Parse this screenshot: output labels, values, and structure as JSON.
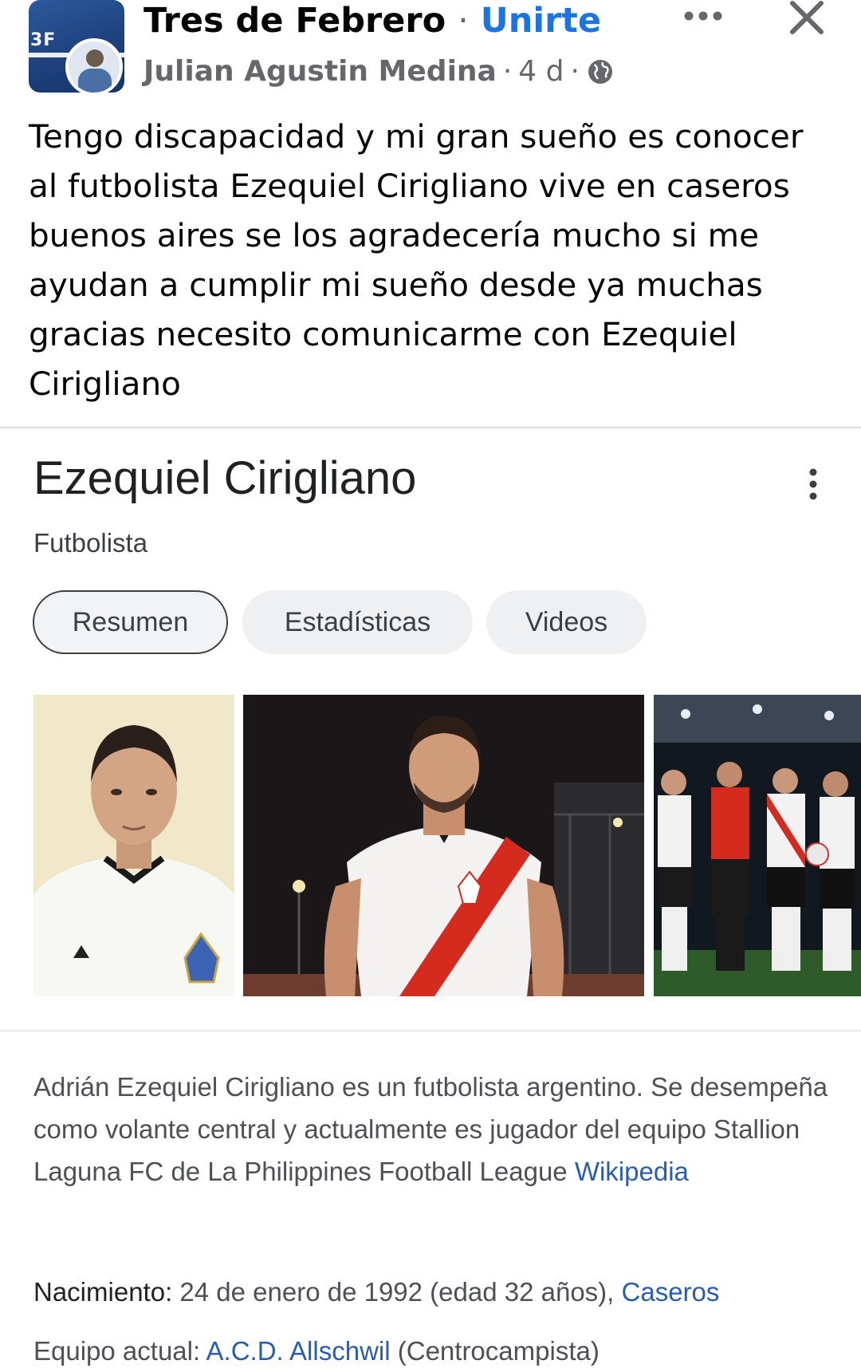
{
  "post": {
    "group_name": "Tres de Febrero",
    "separator": "·",
    "join_label": "Unirte",
    "author": "Julian Agustin Medina",
    "time": "4 d",
    "privacy_icon": "globe-icon",
    "more_icon": "more-horizontal-icon",
    "close_icon": "close-icon",
    "group_avatar_text": "3F",
    "text": "Tengo discapacidad y mi gran sueño es conocer al futbolista Ezequiel Cirigliano vive en caseros buenos aires se los agradecería mucho si me ayudan a cumplir mi sueño desde ya muchas gracias necesito comunicarme con Ezequiel Cirigliano"
  },
  "knowledge_panel": {
    "title": "Ezequiel Cirigliano",
    "subtitle": "Futbolista",
    "tabs": [
      {
        "label": "Resumen",
        "active": true
      },
      {
        "label": "Estadísticas",
        "active": false
      },
      {
        "label": "Videos",
        "active": false
      }
    ],
    "images": [
      {
        "name": "portrait-argentina-jersey"
      },
      {
        "name": "river-plate-jersey-night"
      },
      {
        "name": "team-celebration"
      }
    ],
    "description": "Adrián Ezequiel Cirigliano es un futbolista argentino. Se desempeña como volante central y actualmente es jugador del equipo Stallion Laguna FC de La Philippines Football League",
    "description_source": "Wikipedia",
    "birth": {
      "label": "Nacimiento:",
      "value": "24 de enero de 1992 (edad 32 años),",
      "place": "Caseros"
    },
    "team": {
      "label": "Equipo actual:",
      "value": "A.C.D. Allschwil",
      "extra": "(Centrocampista)"
    }
  },
  "colors": {
    "link_blue": "#1b74e4",
    "google_link": "#2a5db0",
    "river_red": "#d52b1e"
  }
}
